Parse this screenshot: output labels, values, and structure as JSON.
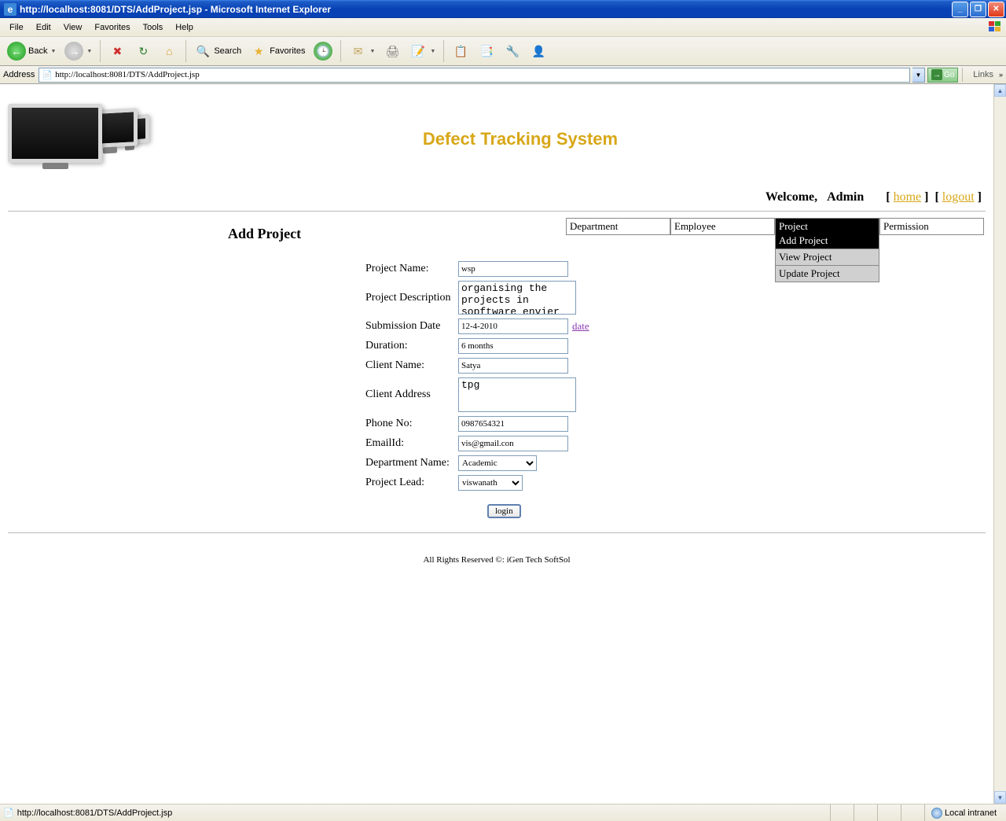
{
  "window": {
    "title": "http://localhost:8081/DTS/AddProject.jsp - Microsoft Internet Explorer"
  },
  "menubar": [
    "File",
    "Edit",
    "View",
    "Favorites",
    "Tools",
    "Help"
  ],
  "toolbar": {
    "back": "Back",
    "search": "Search",
    "favorites": "Favorites"
  },
  "address": {
    "label": "Address",
    "url": "http://localhost:8081/DTS/AddProject.jsp",
    "go": "Go",
    "links": "Links"
  },
  "app": {
    "title": "Defect Tracking System",
    "welcome": "Welcome,",
    "user": "Admin",
    "home": "home",
    "logout": "logout",
    "pageTitle": "Add Project"
  },
  "nav": {
    "items": [
      "Department",
      "Employee",
      "Project",
      "Permission"
    ],
    "submenu": [
      "Add Project",
      "View Project",
      "Update Project"
    ]
  },
  "form": {
    "projectName": {
      "label": "Project Name:",
      "value": "wsp"
    },
    "projectDesc": {
      "label": "Project Description",
      "value": "organising the projects in sopftware envier"
    },
    "submissionDate": {
      "label": "Submission Date",
      "value": "12-4-2010",
      "link": "date"
    },
    "duration": {
      "label": "Duration:",
      "value": "6 months"
    },
    "clientName": {
      "label": "Client Name:",
      "value": "Satya"
    },
    "clientAddress": {
      "label": "Client Address",
      "value": "tpg"
    },
    "phone": {
      "label": "Phone No:",
      "value": "0987654321"
    },
    "email": {
      "label": "EmailId:",
      "value": "vis@gmail.con"
    },
    "deptName": {
      "label": "Department Name:",
      "value": "Academic"
    },
    "projectLead": {
      "label": "Project Lead:",
      "value": "viswanath"
    },
    "submit": "login"
  },
  "footer": "All Rights Reserved ©: iGen Tech SoftSol",
  "status": {
    "left": "http://localhost:8081/DTS/AddProject.jsp",
    "right": "Local intranet"
  }
}
